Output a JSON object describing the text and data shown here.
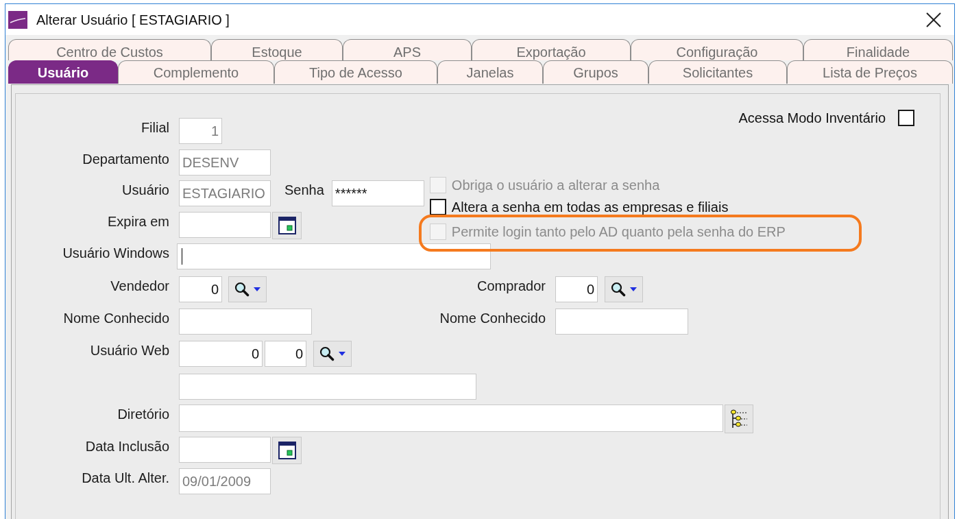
{
  "window": {
    "title": "Alterar Usuário [ ESTAGIARIO ]"
  },
  "tabs": {
    "back_row": [
      {
        "label": "Centro de Custos",
        "selected": false
      },
      {
        "label": "Estoque",
        "selected": false
      },
      {
        "label": "APS",
        "selected": false
      },
      {
        "label": "Exportação",
        "selected": false
      },
      {
        "label": "Configuração",
        "selected": false
      },
      {
        "label": "Finalidade",
        "selected": false
      }
    ],
    "front_row": [
      {
        "label": "Usuário",
        "selected": true
      },
      {
        "label": "Complemento",
        "selected": false
      },
      {
        "label": "Tipo de Acesso",
        "selected": false
      },
      {
        "label": "Janelas",
        "selected": false
      },
      {
        "label": "Grupos",
        "selected": false
      },
      {
        "label": "Solicitantes",
        "selected": false
      },
      {
        "label": "Lista de Preços",
        "selected": false
      }
    ]
  },
  "form": {
    "inventory_mode": {
      "label": "Acessa Modo Inventário",
      "checked": false
    },
    "filial": {
      "label": "Filial",
      "value": "1",
      "disabled": true
    },
    "departamento": {
      "label": "Departamento",
      "value": "DESENV",
      "disabled": true
    },
    "usuario": {
      "label": "Usuário",
      "value": "ESTAGIARIO",
      "disabled": true
    },
    "senha": {
      "label": "Senha",
      "value": "******",
      "disabled": false
    },
    "password_options": [
      {
        "label": "Obriga o usuário a alterar a senha",
        "checked": false,
        "disabled": true,
        "highlighted": false
      },
      {
        "label": "Altera a senha em todas as empresas e filiais",
        "checked": false,
        "disabled": false,
        "highlighted": false
      },
      {
        "label": "Permite login tanto pelo AD quanto pela senha do ERP",
        "checked": false,
        "disabled": true,
        "highlighted": true
      }
    ],
    "expira_em": {
      "label": "Expira em"
    },
    "usuario_windows": {
      "label": "Usuário Windows",
      "focused": true
    },
    "vendedor": {
      "label": "Vendedor",
      "value": "0",
      "disabled": false
    },
    "comprador": {
      "label": "Comprador",
      "value": "0",
      "disabled": false
    },
    "vendedor_nome_conhecido": {
      "label": "Nome Conhecido"
    },
    "comprador_nome_conhecido": {
      "label": "Nome Conhecido"
    },
    "usuario_web": {
      "label": "Usuário Web",
      "values": [
        "0",
        "0"
      ],
      "disabled": false
    },
    "diretorio": {
      "label": "Diretório"
    },
    "data_inclusao": {
      "label": "Data Inclusão"
    },
    "data_ult_alter": {
      "label": "Data Ult. Alter.",
      "value": "09/01/2009",
      "disabled": true
    }
  }
}
